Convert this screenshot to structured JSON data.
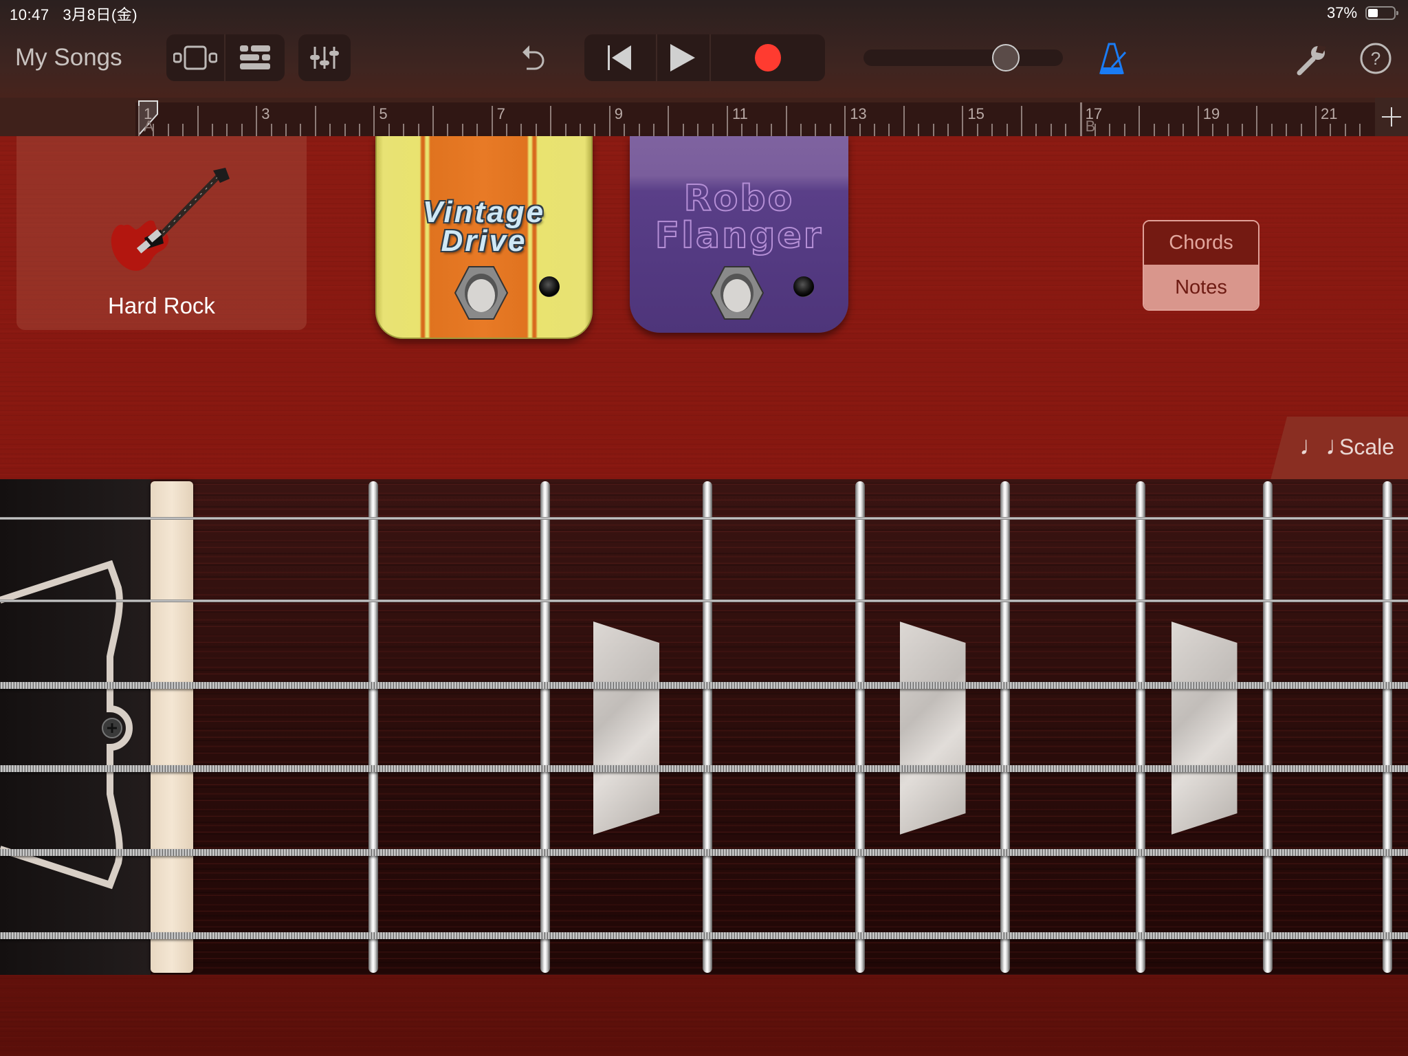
{
  "status_bar": {
    "time": "10:47",
    "date": "3月8日(金)",
    "battery_percent": "37%",
    "battery_level": 0.37
  },
  "toolbar": {
    "my_songs_label": "My Songs",
    "view_buttons": [
      {
        "icon": "instrument-view-icon"
      },
      {
        "icon": "tracks-view-icon"
      }
    ],
    "mixer_icon": "mixer-sliders-icon",
    "undo_icon": "undo-icon",
    "transport": [
      {
        "icon": "go-to-beginning-icon"
      },
      {
        "icon": "play-icon"
      },
      {
        "icon": "record-icon"
      }
    ],
    "master_volume": 0.68,
    "metronome_icon": "metronome-icon",
    "settings_icon": "wrench-icon",
    "help_icon": "help-icon",
    "colors": {
      "record": "#ff3b30",
      "metronome": "#1a7cf5",
      "icon": "#bdb9b7"
    }
  },
  "ruler": {
    "labels": [
      {
        "measure": "1",
        "marker": "A"
      },
      {
        "measure": "3"
      },
      {
        "measure": "5"
      },
      {
        "measure": "7"
      },
      {
        "measure": "9"
      },
      {
        "measure": "11"
      },
      {
        "measure": "13"
      },
      {
        "measure": "15"
      },
      {
        "measure": "17",
        "marker": "B"
      },
      {
        "measure": "19"
      },
      {
        "measure": "21"
      }
    ],
    "add_section_icon": "plus-icon"
  },
  "instrument": {
    "patch_name": "Hard Rock",
    "patch_icon": "electric-guitar-icon",
    "pedals": [
      {
        "name_line1": "Vintage",
        "name_line2": "Drive"
      },
      {
        "name_line1": "Robo",
        "name_line2": "Flanger"
      }
    ],
    "mode_toggle": {
      "options": [
        "Chords",
        "Notes"
      ],
      "selected": "Notes"
    },
    "scale_button": {
      "label": "Scale",
      "icon": "music-notes-icon"
    }
  },
  "fretboard": {
    "strings": 6,
    "frets_visible": 8,
    "inlay_frets": [
      3,
      5,
      7
    ]
  }
}
